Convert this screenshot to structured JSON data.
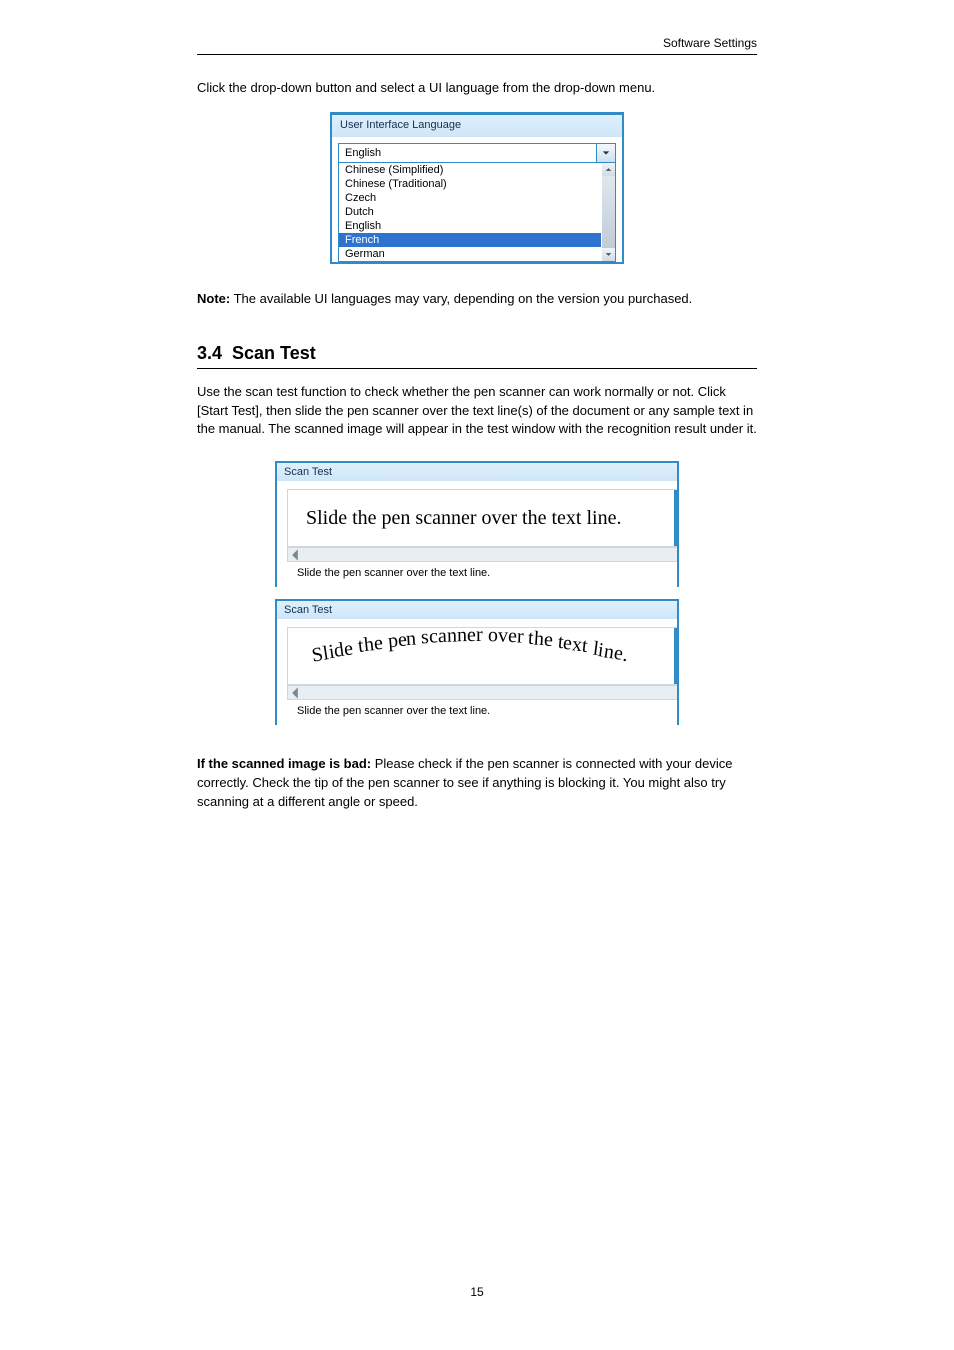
{
  "running_head": "Software Settings",
  "para_before_fig": "Click the drop-down button and select a UI language from the drop-down menu.",
  "lang_panel": {
    "title": "User Interface Language",
    "selected": "English",
    "options": [
      "Chinese (Simplified)",
      "Chinese (Traditional)",
      "Czech",
      "Dutch",
      "English",
      "French",
      "German"
    ],
    "highlight_index": 5
  },
  "para_note_lead": "Note:",
  "para_note_body": "The available UI languages may vary, depending on the version you purchased.",
  "section": {
    "num": "3.4",
    "title": "Scan Test"
  },
  "para_scan_intro": "Use the scan test function to check whether the pen scanner can work normally or not. Click [Start Test], then slide the pen scanner over the text line(s) of the document or any sample text in the manual. The scanned image will appear in the test window with the recognition result under it.",
  "scan_panels": {
    "title": "Scan Test",
    "image_text": "Slide the pen scanner over the text line.",
    "result_text": "Slide the pen scanner over the text line."
  },
  "para_bad_lead": "If the scanned image is bad:",
  "para_bad_body": "Please check if the pen scanner is connected with your device correctly. Check the tip of the pen scanner to see if anything is blocking it. You might also try scanning at a different angle or speed.",
  "page_number": "15"
}
